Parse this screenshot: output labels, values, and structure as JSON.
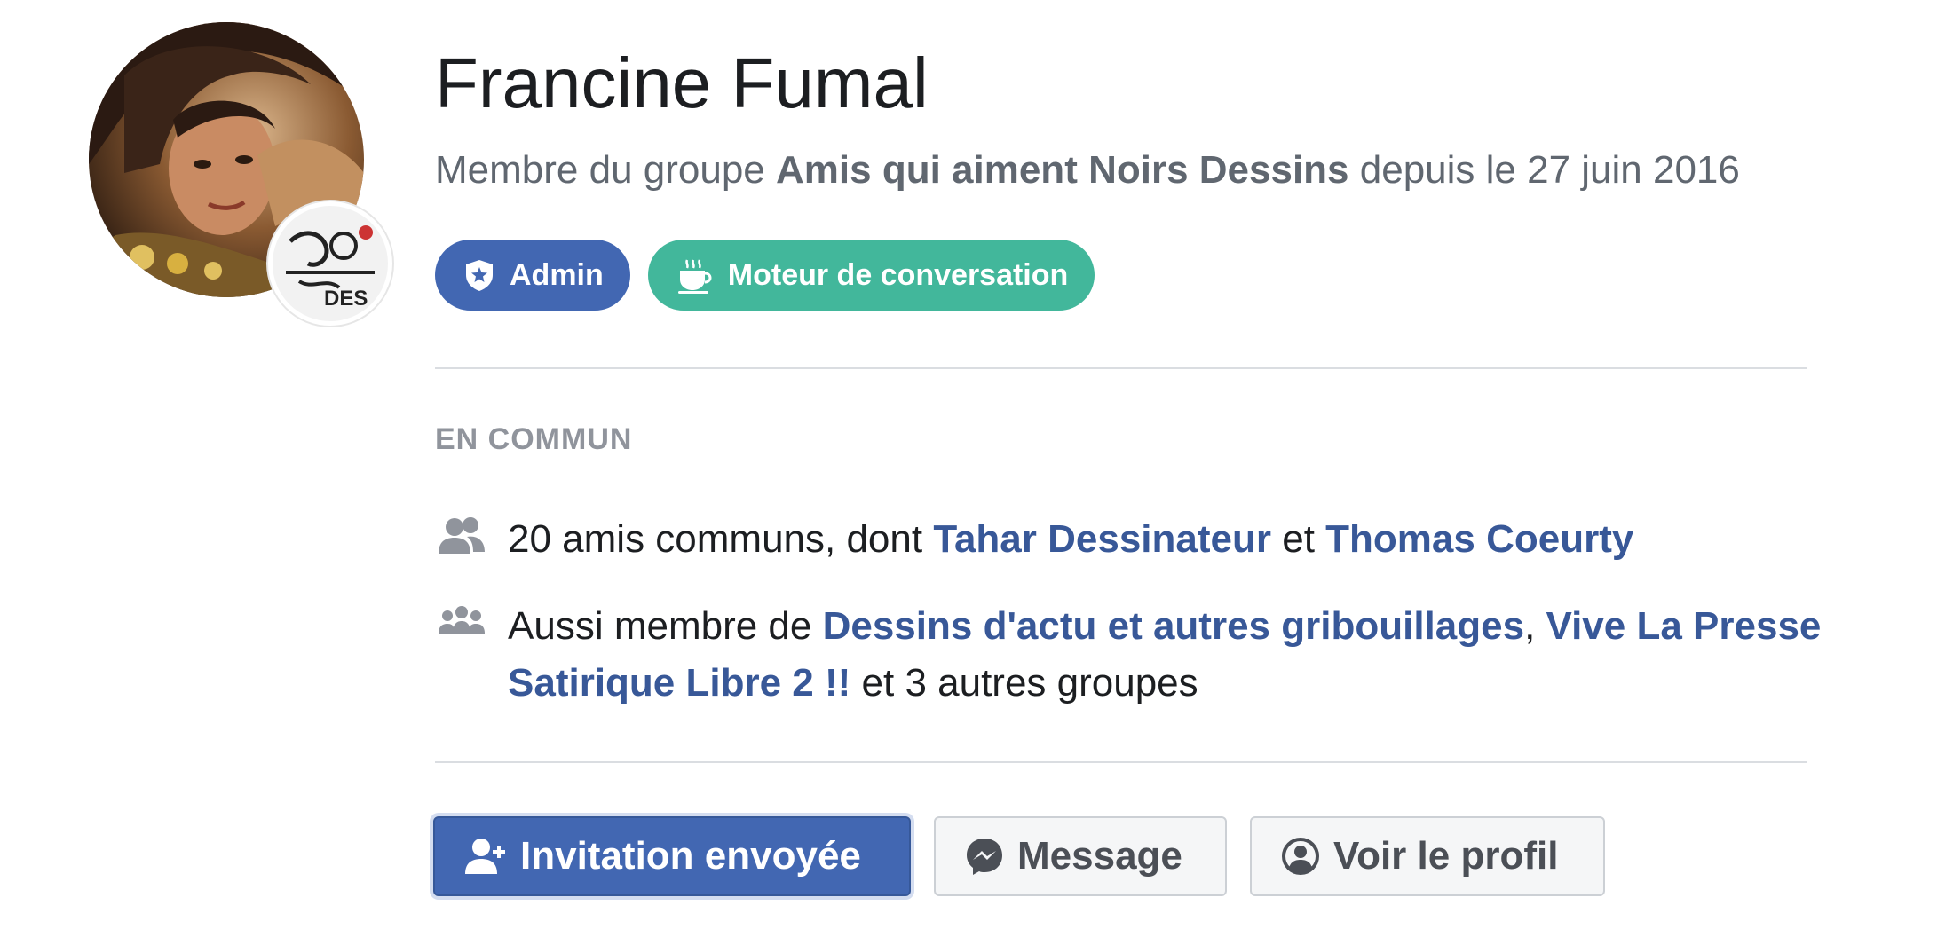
{
  "profile": {
    "name": "Francine Fumal",
    "member_prefix": "Membre du groupe ",
    "group_name": "Amis qui aiment Noirs Dessins",
    "member_suffix": " depuis le 27 juin 2016",
    "avatar_icon": "profile-photo",
    "group_badge_icon": "group-logo-icon"
  },
  "badges": [
    {
      "label": "Admin",
      "icon": "shield-star-icon",
      "color": "#4267b2"
    },
    {
      "label": "Moteur de conversation",
      "icon": "coffee-cup-icon",
      "color": "#42b79b"
    }
  ],
  "in_common": {
    "title": "EN COMMUN",
    "friends": {
      "icon": "friends-icon",
      "prefix": "20 amis communs, dont ",
      "friend1": "Tahar Dessinateur",
      "between": " et ",
      "friend2": "Thomas Coeurty"
    },
    "groups": {
      "icon": "groups-icon",
      "prefix": "Aussi membre de ",
      "group1": "Dessins d'actu et autres gribouillages",
      "sep": ", ",
      "group2": "Vive La Presse Satirique Libre 2 !!",
      "suffix": " et 3 autres groupes"
    }
  },
  "actions": {
    "invite": {
      "label": "Invitation envoyée",
      "icon": "add-friend-icon"
    },
    "message": {
      "label": "Message",
      "icon": "messenger-icon"
    },
    "profile": {
      "label": "Voir le profil",
      "icon": "user-circle-icon"
    }
  },
  "colors": {
    "accent": "#4267b2",
    "link": "#385898",
    "teal": "#42b79b",
    "muted": "#606770"
  }
}
